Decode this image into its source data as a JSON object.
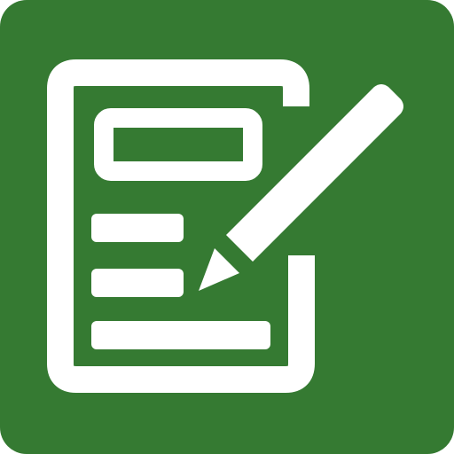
{
  "icon": {
    "semantic_name": "form-edit-icon",
    "parts": [
      "document-icon",
      "text-field-icon",
      "text-line-icon",
      "pencil-icon"
    ]
  },
  "colors": {
    "tile_green": "#357A32",
    "foreground_white": "#FFFFFF",
    "background": "#FFFFFF"
  }
}
